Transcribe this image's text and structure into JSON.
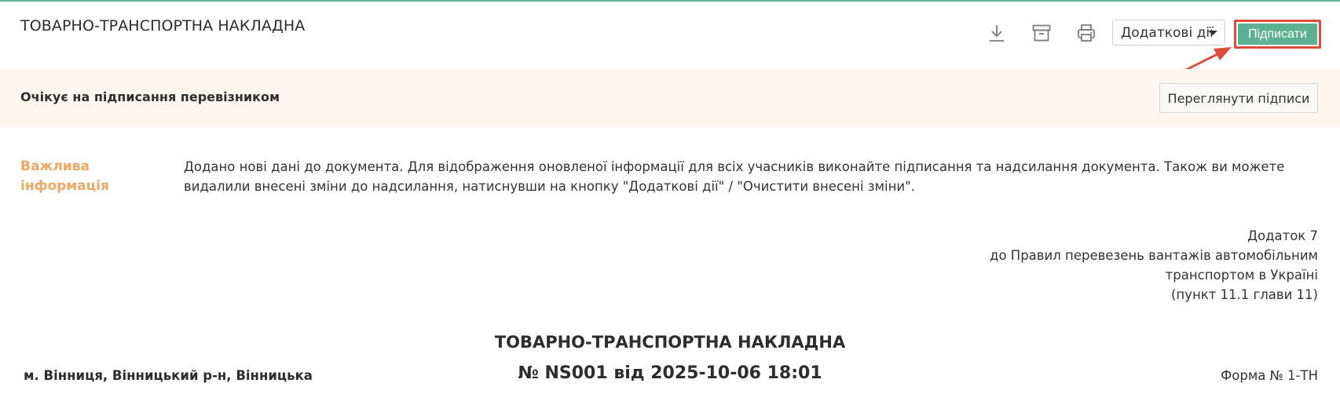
{
  "header": {
    "title": "ТОВАРНО-ТРАНСПОРТНА НАКЛАДНА",
    "actions_label": "Додаткові дії",
    "sign_label": "Підписати",
    "icons": [
      "download-icon",
      "archive-icon",
      "print-icon"
    ]
  },
  "status": {
    "text": "Очікує на підписання перевізником",
    "view_signatures_label": "Переглянути підписи"
  },
  "info": {
    "label_line1": "Важлива",
    "label_line2": "інформація",
    "text": "Додано нові дані до документа. Для відображення оновленої інформації для всіх учасників виконайте підписання та надсилання документа. Також ви можете видалили внесені зміни до надсилання, натиснувши на кнопку \"Додаткові дії\" / \"Очистити внесені зміни\"."
  },
  "appendix": {
    "line1": "Додаток 7",
    "line2": "до Правил перевезень вантажів автомобільним",
    "line3": "транспортом в Україні",
    "line4": "(пункт 11.1 глави 11)"
  },
  "document": {
    "form_title": "ТОВАРНО-ТРАНСПОРТНА НАКЛАДНА",
    "number": "№ NS001 від 2025-10-06 18:01",
    "city": "м. Вінниця, Вінницький р-н, Вінницька",
    "form_number": "Форма № 1-ТН"
  },
  "colors": {
    "accent": "#5cb193",
    "highlight": "#e04b3c",
    "status_bg": "#fdf5ef",
    "info_label": "#eda962"
  }
}
